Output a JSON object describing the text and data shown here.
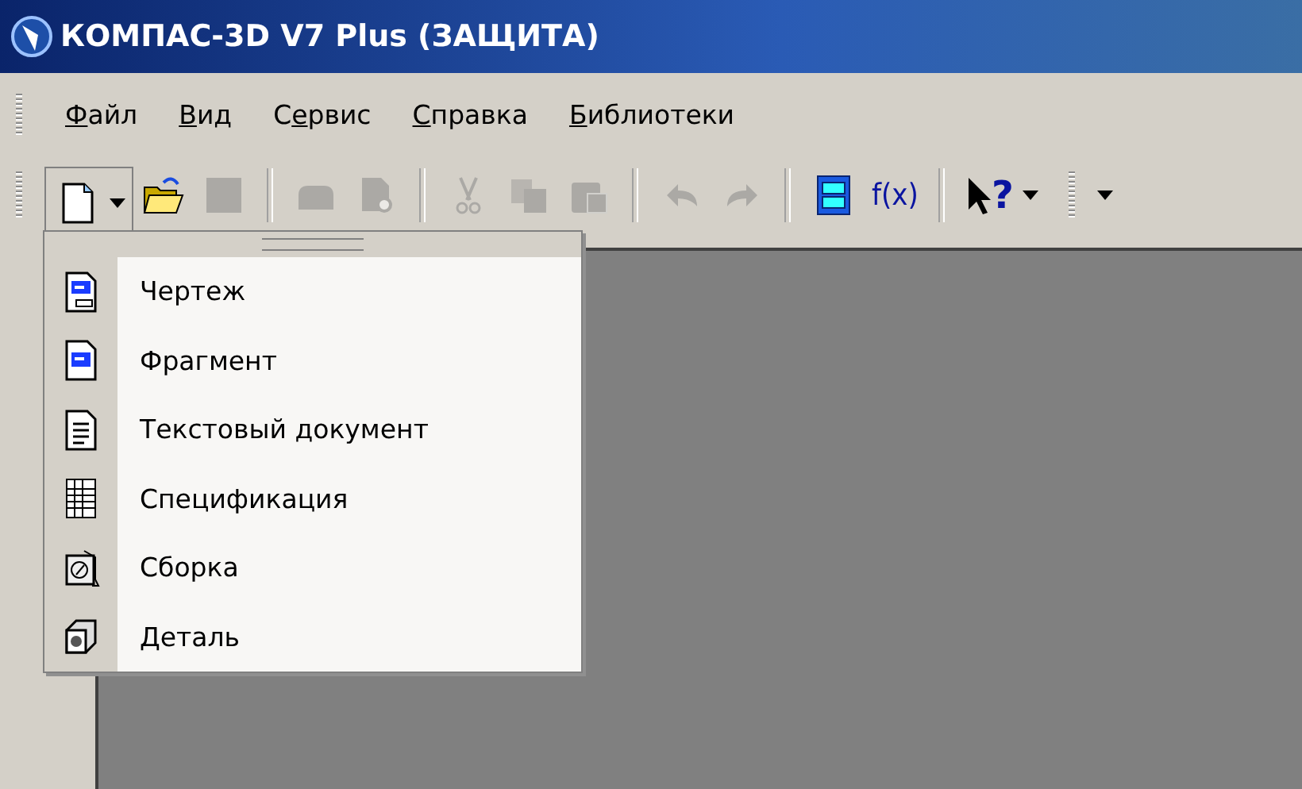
{
  "window": {
    "title": "КОМПАС-3D V7 Plus (ЗАЩИТА)"
  },
  "menu_bar": [
    {
      "key": "Ф",
      "post": "айл"
    },
    {
      "key": "В",
      "post": "ид"
    },
    {
      "pre": "С",
      "key": "е",
      "post": "рвис"
    },
    {
      "key": "С",
      "post": "правка"
    },
    {
      "key": "Б",
      "post": "иблиотеки"
    }
  ],
  "toolbar": [
    {
      "kind": "new",
      "disabled": false,
      "pressed": true
    },
    {
      "kind": "open",
      "disabled": false,
      "pressed": false
    },
    {
      "kind": "save",
      "disabled": true,
      "pressed": false
    },
    {
      "kind": "sep"
    },
    {
      "kind": "print",
      "disabled": true,
      "pressed": false
    },
    {
      "kind": "preview",
      "disabled": true,
      "pressed": false
    },
    {
      "kind": "sep"
    },
    {
      "kind": "cut",
      "disabled": true,
      "pressed": false
    },
    {
      "kind": "copy",
      "disabled": true,
      "pressed": false
    },
    {
      "kind": "paste",
      "disabled": true,
      "pressed": false
    },
    {
      "kind": "sep"
    },
    {
      "kind": "undo",
      "disabled": true,
      "pressed": false
    },
    {
      "kind": "redo",
      "disabled": true,
      "pressed": false
    },
    {
      "kind": "sep"
    },
    {
      "kind": "library",
      "disabled": false,
      "pressed": false
    },
    {
      "kind": "text",
      "label": "f(x)",
      "disabled": false,
      "pressed": false
    },
    {
      "kind": "sep"
    },
    {
      "kind": "help",
      "label": "?",
      "disabled": false,
      "pressed": false
    }
  ],
  "new_menu": {
    "items": [
      {
        "kind": "drawing",
        "label": "Чертеж"
      },
      {
        "kind": "fragment",
        "label": "Фрагмент"
      },
      {
        "kind": "textdoc",
        "label": "Текстовый документ"
      },
      {
        "kind": "spec",
        "label": "Спецификация"
      },
      {
        "kind": "assembly",
        "label": "Сборка"
      },
      {
        "kind": "part",
        "label": "Деталь"
      }
    ]
  }
}
